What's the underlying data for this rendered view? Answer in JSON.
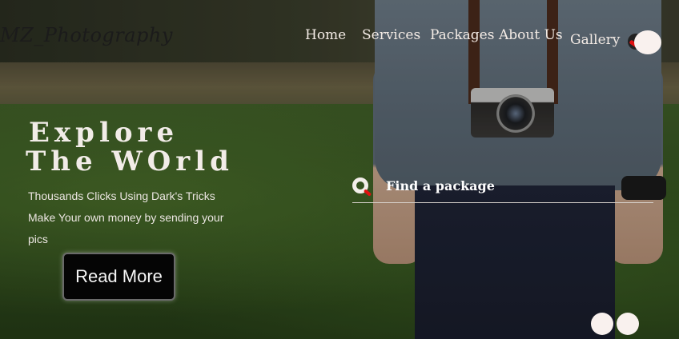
{
  "brand": {
    "logo_text": "MZ_Photography"
  },
  "nav": {
    "items": [
      {
        "label": "Home"
      },
      {
        "label": "Services"
      },
      {
        "label": "Packages"
      },
      {
        "label": "About Us"
      },
      {
        "label": "Gallery"
      }
    ]
  },
  "hero": {
    "title_line1": "Explore",
    "title_line2": "The WOrld",
    "description": "Thousands Clicks Using Dark's Tricks Make Your own money by sending your pics",
    "button_label": "Read More"
  },
  "search": {
    "placeholder": "Find a package",
    "value": ""
  },
  "slider": {
    "dot_count": 2
  },
  "colors": {
    "nav_text": "#f4ece6",
    "button_bg": "#050505",
    "accent_red": "#e01010",
    "dot": "#f9f1ee"
  },
  "icons": {
    "search": "search-icon",
    "theme_toggle": "toggle-icon"
  }
}
